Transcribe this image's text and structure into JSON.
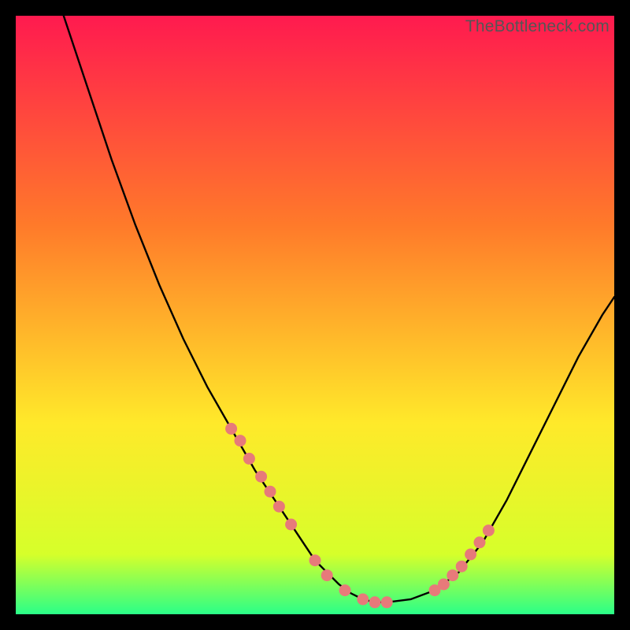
{
  "watermark": "TheBottleneck.com",
  "colors": {
    "bg": "#000000",
    "grad_top": "#ff1a4f",
    "grad_mid1": "#ff7a2a",
    "grad_mid2": "#ffe92a",
    "grad_bot1": "#d6ff2a",
    "grad_bot2": "#2aff88",
    "curve": "#000000",
    "marker": "#e77a7a"
  },
  "chart_data": {
    "type": "line",
    "title": "",
    "xlabel": "",
    "ylabel": "",
    "xlim": [
      0,
      100
    ],
    "ylim": [
      0,
      100
    ],
    "series": [
      {
        "name": "curve",
        "x": [
          8,
          12,
          16,
          20,
          24,
          28,
          32,
          36,
          40,
          44,
          48,
          50,
          52,
          54,
          56,
          58,
          60,
          62,
          66,
          70,
          74,
          78,
          82,
          86,
          90,
          94,
          98,
          100
        ],
        "y": [
          100,
          88,
          76,
          65,
          55,
          46,
          38,
          31,
          24,
          18,
          12,
          9,
          7,
          5,
          3.5,
          2.5,
          2,
          2,
          2.5,
          4,
          7,
          12,
          19,
          27,
          35,
          43,
          50,
          53
        ]
      }
    ],
    "markers": {
      "name": "highlight-points",
      "x": [
        36,
        37.5,
        39,
        41,
        42.5,
        44,
        46,
        50,
        52,
        55,
        58,
        60,
        62,
        70,
        71.5,
        73,
        74.5,
        76,
        77.5,
        79
      ],
      "y": [
        31,
        29,
        26,
        23,
        20.5,
        18,
        15,
        9,
        6.5,
        4,
        2.5,
        2,
        2,
        4,
        5,
        6.5,
        8,
        10,
        12,
        14
      ]
    },
    "annotations": []
  }
}
